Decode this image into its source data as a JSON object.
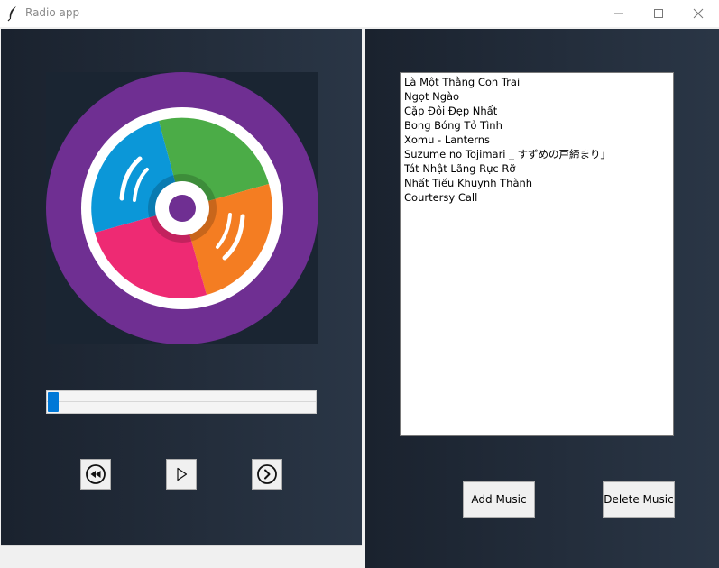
{
  "window": {
    "title": "Radio app",
    "app_icon": "feather-icon",
    "controls": [
      "minimize-icon",
      "maximize-icon",
      "close-icon"
    ]
  },
  "player": {
    "artwork_icon": "vinyl-disc-icon",
    "progress_fraction": 0.0,
    "controls": [
      {
        "name": "previous-button",
        "icon": "rewind-icon"
      },
      {
        "name": "play-button",
        "icon": "play-icon"
      },
      {
        "name": "next-button",
        "icon": "next-circle-icon"
      }
    ]
  },
  "playlist": {
    "items": [
      "Là Một Thằng Con Trai",
      "Ngọt Ngào",
      "Cặp Đôi Đẹp Nhất",
      "Bong Bóng Tỏ Tình",
      "Xomu - Lanterns",
      "Suzume no Tojimari _ すずめの戸締まり」",
      "Tát Nhật Lãng Rực Rỡ",
      "Nhất Tiếu Khuynh Thành",
      "Courtersy Call"
    ]
  },
  "actions": {
    "add_label": "Add Music",
    "delete_label": "Delete Music"
  },
  "colors": {
    "panel_dark": "#1a222e",
    "accent_blue": "#0078d7",
    "disc_purple": "#6f2f92",
    "disc_green": "#4bac47",
    "disc_orange": "#f47d22",
    "disc_pink": "#ee2a73",
    "disc_blue": "#0b97d8"
  }
}
